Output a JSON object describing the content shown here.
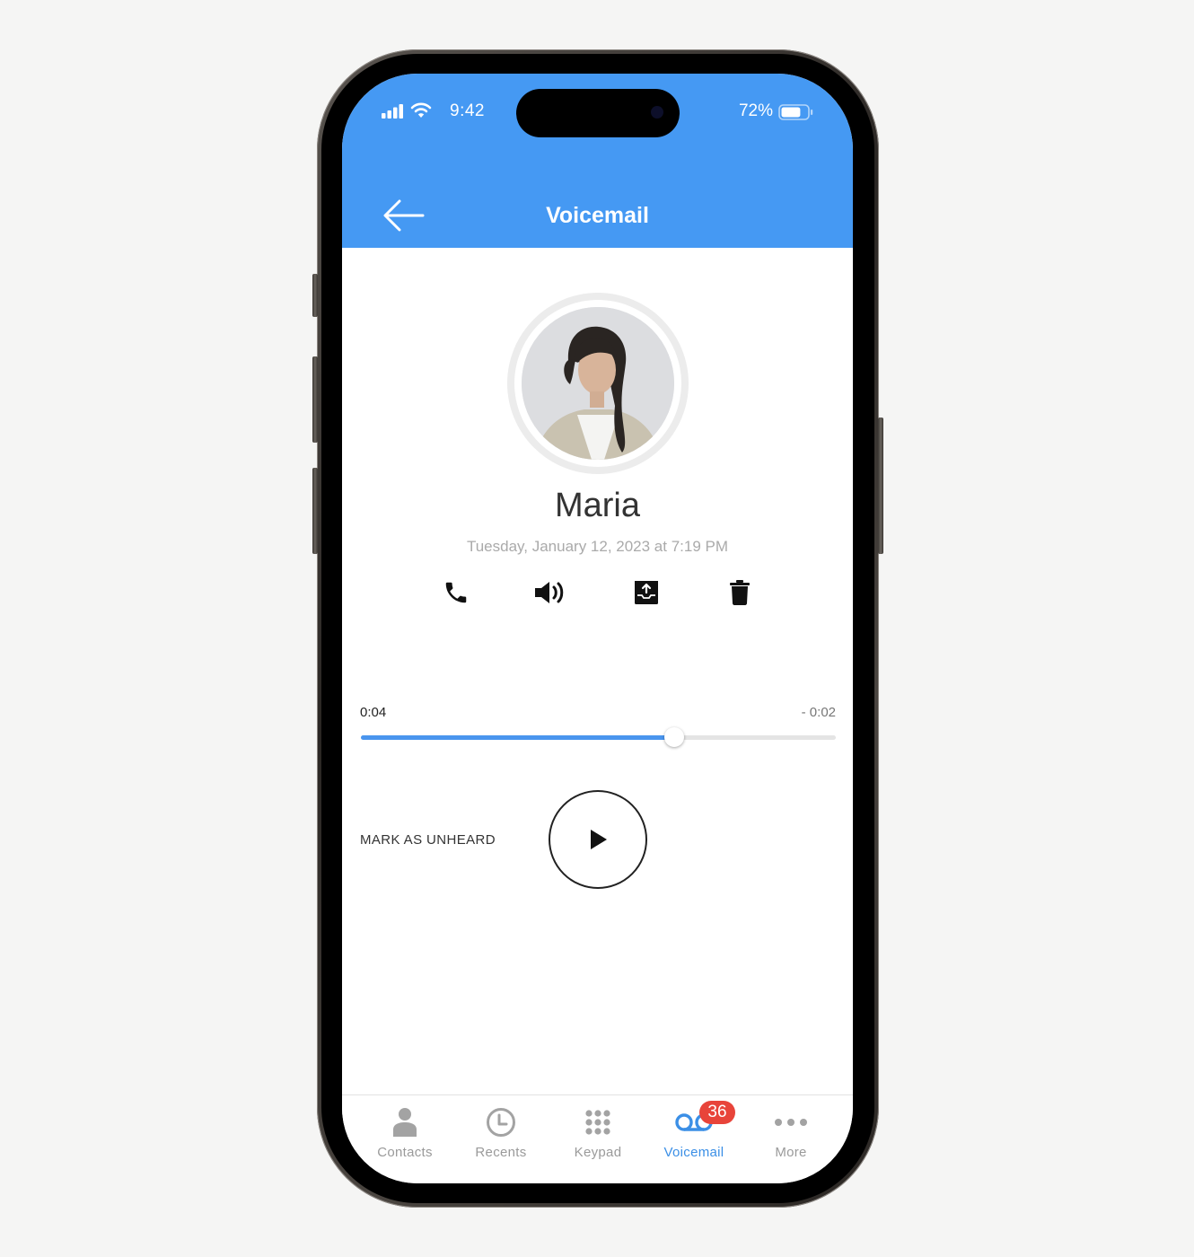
{
  "status_bar": {
    "time": "9:42",
    "battery_percent": "72%",
    "battery_level": 0.72
  },
  "header": {
    "title": "Voicemail",
    "back_icon": "arrow-left-icon",
    "color": "#4599f3"
  },
  "voicemail": {
    "contact_name": "Maria",
    "received": "Tuesday, January 12, 2023 at 7:19 PM",
    "actions": [
      {
        "name": "call",
        "icon": "phone-icon"
      },
      {
        "name": "speaker",
        "icon": "speaker-icon"
      },
      {
        "name": "share",
        "icon": "share-upload-icon"
      },
      {
        "name": "delete",
        "icon": "trash-icon"
      }
    ]
  },
  "player": {
    "elapsed": "0:04",
    "remaining": "- 0:02",
    "progress": 0.66,
    "accent": "#4a95ee",
    "mark_unheard_label": "MARK AS UNHEARD",
    "play_icon": "play-icon"
  },
  "tabbar": {
    "items": [
      {
        "label": "Contacts",
        "icon": "person-icon",
        "active": false
      },
      {
        "label": "Recents",
        "icon": "clock-icon",
        "active": false
      },
      {
        "label": "Keypad",
        "icon": "keypad-icon",
        "active": false
      },
      {
        "label": "Voicemail",
        "icon": "voicemail-icon",
        "active": true,
        "badge": "36"
      },
      {
        "label": "More",
        "icon": "more-dots-icon",
        "active": false
      }
    ],
    "active_color": "#3b8fe6",
    "badge_color": "#e8443a"
  }
}
